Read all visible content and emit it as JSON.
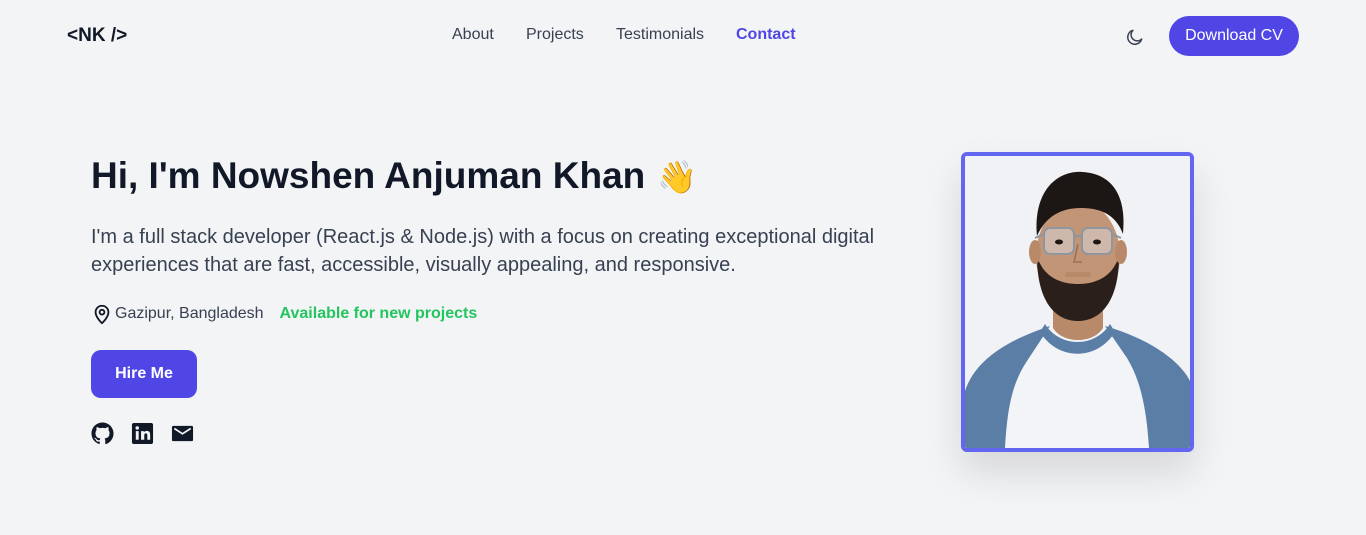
{
  "nav": {
    "logo": "<NK />",
    "links": [
      "About",
      "Projects",
      "Testimonials",
      "Contact"
    ],
    "download_cv": "Download CV",
    "theme_icon": "moon-icon"
  },
  "hero": {
    "title": "Hi, I'm Nowshen Anjuman Khan",
    "wave": "👋",
    "description": "I'm a full stack developer (React.js & Node.js) with a focus on creating exceptional digital experiences that are fast, accessible, visually appealing, and responsive.",
    "location": "Gazipur, Bangladesh",
    "availability": "Available for new projects",
    "hire_button": "Hire Me",
    "socials": [
      "github-icon",
      "linkedin-icon",
      "mail-icon"
    ]
  },
  "colors": {
    "accent": "#4f46e5",
    "available": "#22c55e",
    "background": "#f3f4f6",
    "photo_border": "#6366f1"
  }
}
